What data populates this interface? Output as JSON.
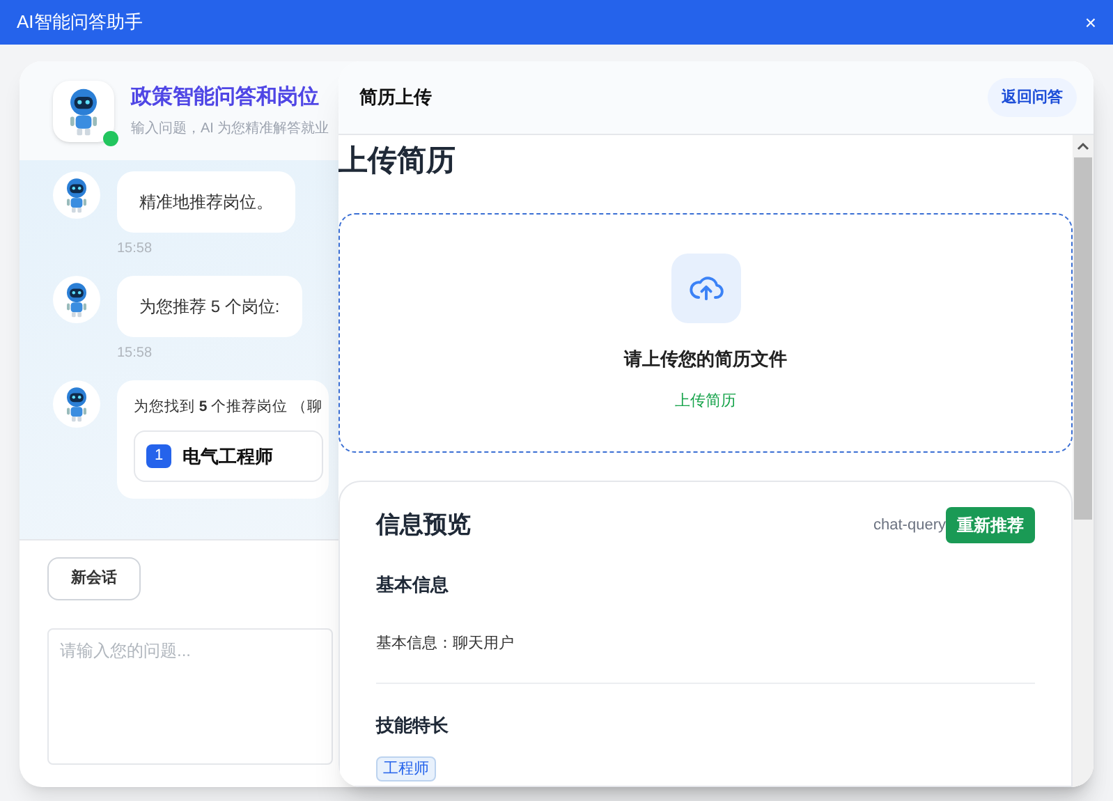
{
  "window": {
    "title": "AI智能问答助手",
    "close": "×"
  },
  "chat": {
    "title": "政策智能问答和岗位",
    "subtitle": "输入问题，AI 为您精准解答就业",
    "online": true,
    "messages": [
      {
        "kind": "text",
        "text": "精准地推荐岗位。",
        "time": "15:58"
      },
      {
        "kind": "text",
        "text": "为您推荐 5 个岗位:",
        "time": "15:58"
      },
      {
        "kind": "jobs",
        "text": "为您找到 **5** 个推荐岗位 （聊",
        "jobs": [
          {
            "rank": "1",
            "title": "电气工程师"
          }
        ]
      }
    ],
    "new_chat_button": "新会话",
    "input": {
      "placeholder": "请输入您的问题..."
    }
  },
  "panel": {
    "title": "简历上传",
    "back_button": "返回问答",
    "heading": "上传简历",
    "upload": {
      "prompt": "请上传您的简历文件",
      "link": "上传简历"
    },
    "preview": {
      "title": "信息预览",
      "source": "chat-query",
      "refresh_button": "重新推荐",
      "sections": [
        {
          "kind": "fields",
          "title": "基本信息",
          "items": [
            {
              "label": "基本信息：",
              "value": "聊天用户"
            }
          ]
        },
        {
          "kind": "tags",
          "title": "技能特长",
          "tags": [
            "工程师"
          ]
        }
      ]
    }
  }
}
